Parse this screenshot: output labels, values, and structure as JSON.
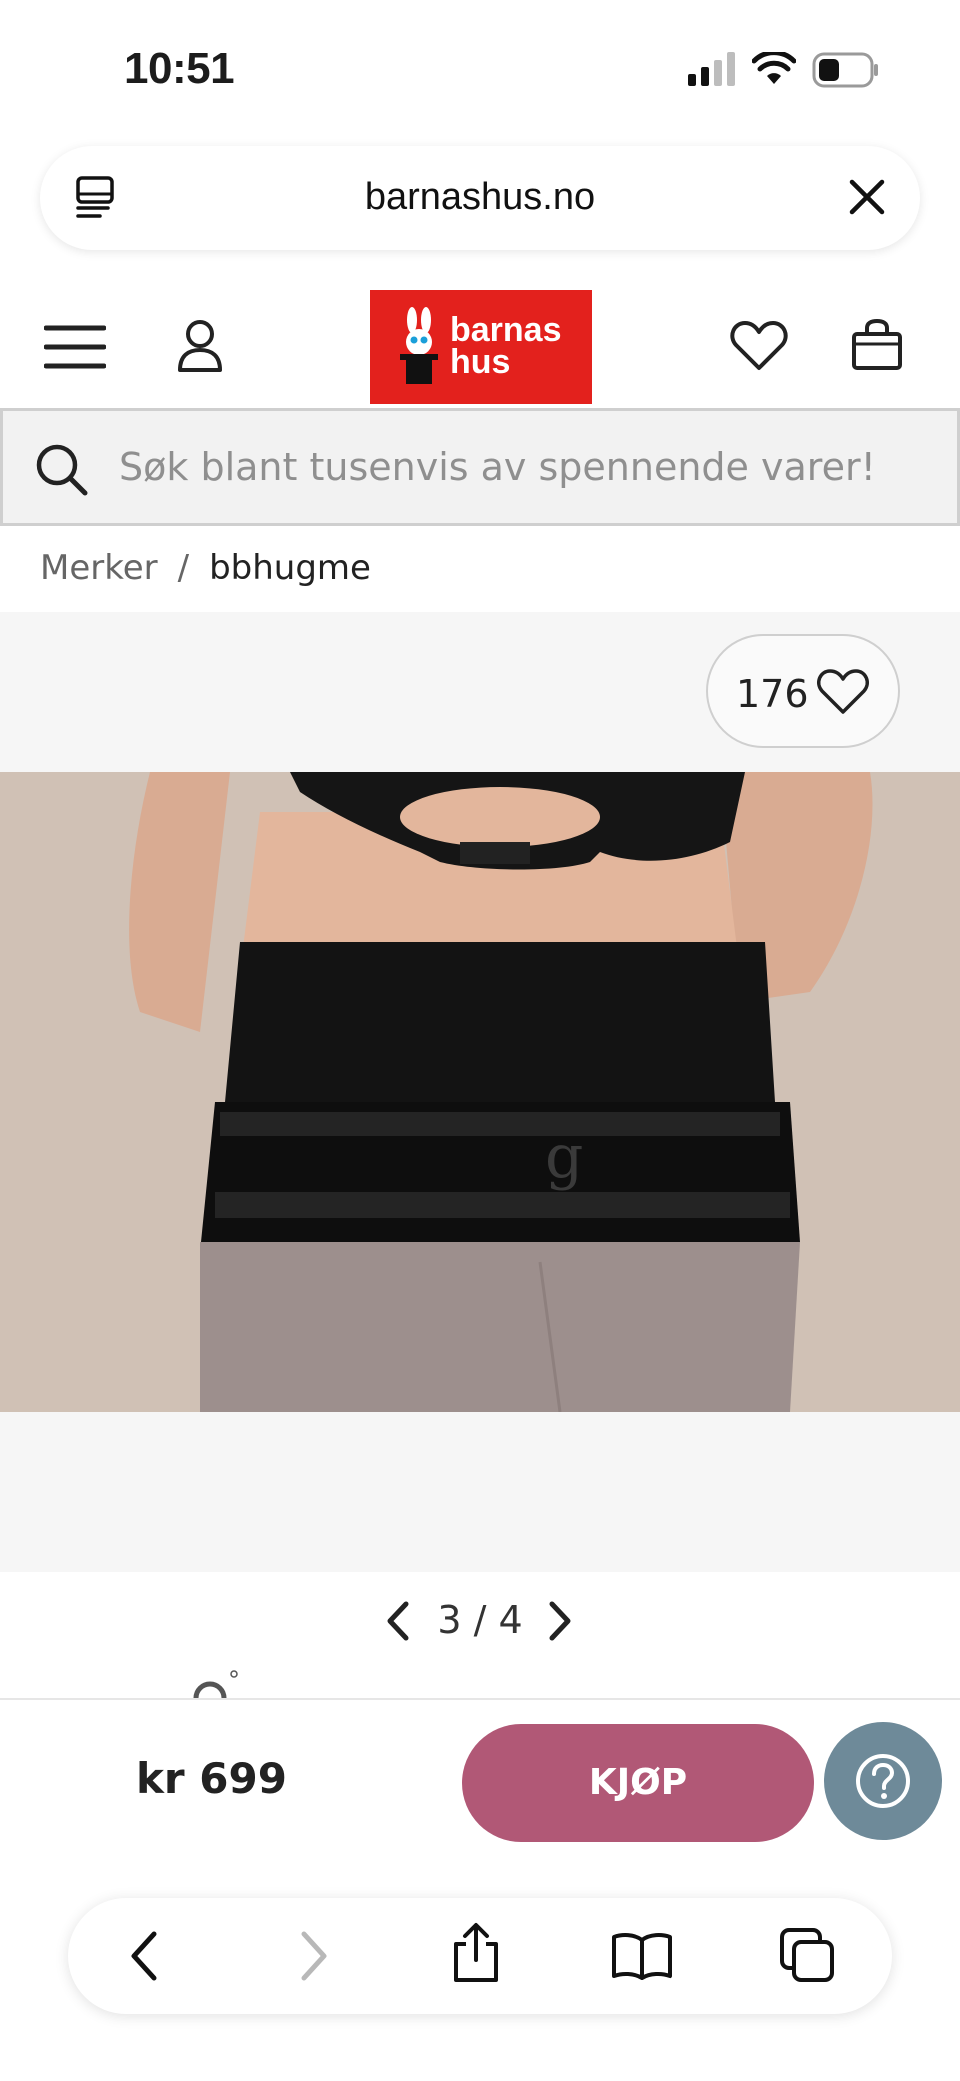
{
  "status_bar": {
    "time": "10:51",
    "icons": [
      "signal-icon",
      "wifi-icon",
      "battery-icon"
    ]
  },
  "browser": {
    "url": "barnashus.no",
    "icons": [
      "tab-overview-icon",
      "close-icon"
    ]
  },
  "header": {
    "logo_line1": "barnas",
    "logo_line2": "hus",
    "brand_color": "#e3211d",
    "icons": [
      "menu-icon",
      "account-icon",
      "heart-icon",
      "shopping-bag-icon"
    ]
  },
  "search": {
    "placeholder": "Søk blant tusenvis av spennende varer!"
  },
  "breadcrumb": {
    "items": [
      "Merker",
      "bbhugme"
    ],
    "separator": "/"
  },
  "gallery": {
    "likes": "176",
    "current": "3",
    "separator": "/",
    "total": "4"
  },
  "buy_bar": {
    "price": "kr 699",
    "buy_label": "KJØP",
    "buy_color": "#b15876",
    "help_color": "#6e8a99"
  },
  "toolbar": {
    "icons": [
      "back-icon",
      "forward-icon",
      "share-icon",
      "bookmarks-icon",
      "tabs-icon"
    ]
  }
}
